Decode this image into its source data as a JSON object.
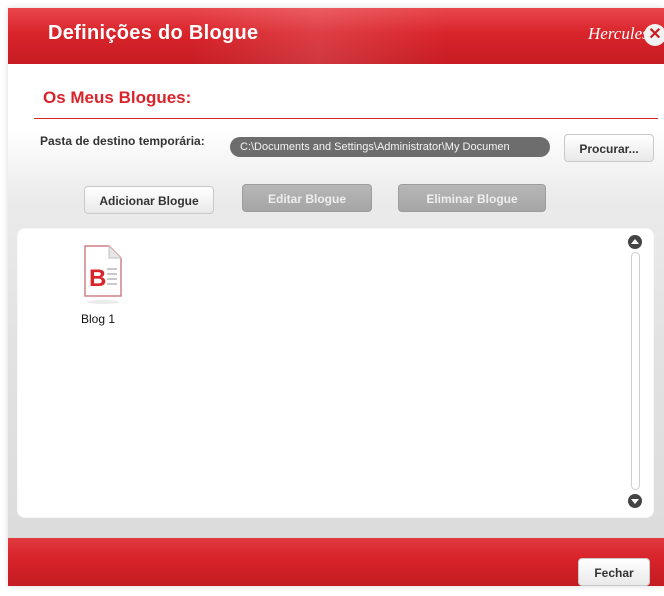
{
  "window": {
    "title": "Definições do Blogue",
    "brand": "Hercules",
    "close_glyph": "✕"
  },
  "section": {
    "title": "Os Meus Blogues:"
  },
  "folder": {
    "label": "Pasta de destino temporária:",
    "path_value": "C:\\Documents and Settings\\Administrator\\My Documen",
    "browse_label": "Procurar..."
  },
  "actions": {
    "add_label": "Adicionar Blogue",
    "edit_label": "Editar Blogue",
    "delete_label": "Eliminar Blogue"
  },
  "blogs": [
    {
      "name": "Blog 1",
      "icon": "blog-document-icon"
    }
  ],
  "footer": {
    "close_label": "Fechar"
  },
  "colors": {
    "accent_red": "#d9242b",
    "path_field_bg": "#6d6d6d",
    "disabled_button": "#aaaaaa"
  }
}
